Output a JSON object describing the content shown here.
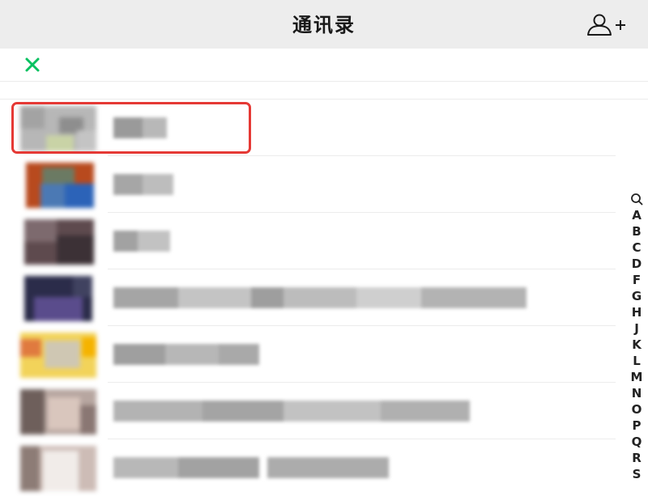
{
  "header": {
    "title": "通讯录",
    "add_contact_icon": "add-contact-icon"
  },
  "search": {
    "close_icon": "close-icon",
    "close_color": "#07c160"
  },
  "contacts": [
    {
      "name": "",
      "avatar": "blurred",
      "selected": true
    },
    {
      "name": "",
      "avatar": "blurred",
      "selected": false
    },
    {
      "name": "",
      "avatar": "blurred",
      "selected": false
    },
    {
      "name": "",
      "avatar": "blurred",
      "selected": false
    },
    {
      "name": "",
      "avatar": "blurred",
      "selected": false
    },
    {
      "name": "",
      "avatar": "blurred",
      "selected": false
    },
    {
      "name": "",
      "avatar": "blurred",
      "selected": false
    }
  ],
  "highlight_color": "#e53935",
  "index": {
    "search_icon": "search-icon",
    "letters": [
      "A",
      "B",
      "C",
      "D",
      "F",
      "G",
      "H",
      "J",
      "K",
      "L",
      "M",
      "N",
      "O",
      "P",
      "Q",
      "R",
      "S"
    ]
  }
}
